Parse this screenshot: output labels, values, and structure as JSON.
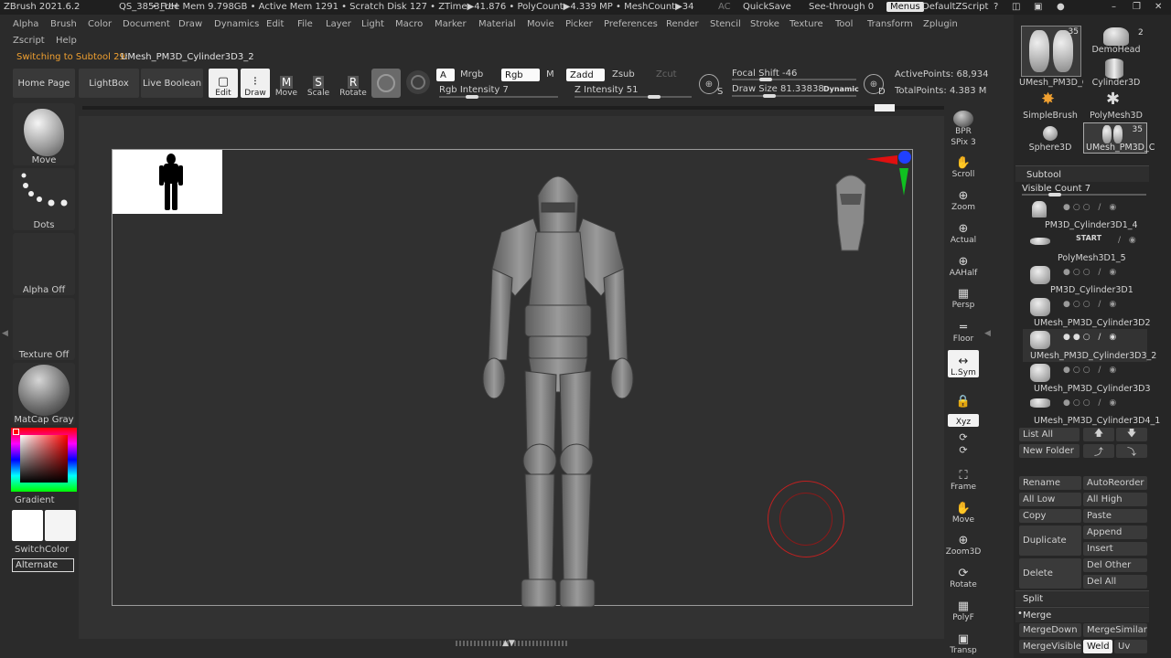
{
  "titlebar": {
    "app": "ZBrush 2021.6.2",
    "doc": "QS_3853_UH",
    "stats": "• Free Mem 9.798GB • Active Mem 1291 • Scratch Disk 127 •  ZTime▶41.876 • PolyCount▶4.339 MP  • MeshCount▶34",
    "ac": "AC",
    "quicksave": "QuickSave",
    "seethrough": "See-through  0",
    "menus": "Menus",
    "script": "DefaultZScript"
  },
  "menus": [
    "Alpha",
    "Brush",
    "Color",
    "Document",
    "Draw",
    "Dynamics",
    "Edit",
    "File",
    "Layer",
    "Light",
    "Macro",
    "Marker",
    "Material",
    "Movie",
    "Picker",
    "Preferences",
    "Render",
    "Stencil",
    "Stroke",
    "Texture",
    "Tool",
    "Transform",
    "Zplugin"
  ],
  "menus2": [
    "Zscript",
    "Help"
  ],
  "status": {
    "prefix": "Switching to Subtool 29:",
    "name": "UMesh_PM3D_Cylinder3D3_2"
  },
  "toolbar": {
    "home": "Home Page",
    "lightbox": "LightBox",
    "liveboolean": "Live Boolean",
    "edit": "Edit",
    "draw": "Draw",
    "move": "Move",
    "scale": "Scale",
    "rotate": "Rotate",
    "a": "A",
    "mrgb": "Mrgb",
    "rgb": "Rgb",
    "m": "M",
    "zadd": "Zadd",
    "zsub": "Zsub",
    "zcut": "Zcut",
    "rgb_intensity": "Rgb Intensity 7",
    "z_intensity": "Z Intensity 51",
    "focal_shift": "Focal Shift -46",
    "draw_size": "Draw Size 81.33838",
    "dynamic": "Dynamic",
    "s": "S",
    "d": "D",
    "active_points": "ActivePoints: 68,934",
    "total_points": "TotalPoints: 4.383 M"
  },
  "left": {
    "move": "Move",
    "dots": "Dots",
    "alpha": "Alpha Off",
    "texture": "Texture Off",
    "matcap": "MatCap Gray",
    "gradient": "Gradient",
    "switchcolor": "SwitchColor",
    "alternate": "Alternate"
  },
  "righttools": [
    "BPR",
    "SPix 3",
    "Scroll",
    "Zoom",
    "Actual",
    "AAHalf",
    "Persp",
    "Floor",
    "L.Sym",
    "Xyz",
    "Frame",
    "Move",
    "Zoom3D",
    "Rotate",
    "PolyF",
    "Transp"
  ],
  "tools": {
    "t1": "UMesh_PM3D_C",
    "t1n": "35",
    "t2": "DemoHead",
    "t2n": "2",
    "t3": "Cylinder3D",
    "t4": "SimpleBrush",
    "t5": "PolyMesh3D",
    "t6": "Sphere3D",
    "t7": "UMesh_PM3D_C",
    "t7n": "35"
  },
  "subtool": {
    "header": "Subtool",
    "visible": "Visible Count 7",
    "items": [
      "PM3D_Cylinder3D1_4",
      "PolyMesh3D1_5",
      "PM3D_Cylinder3D1",
      "UMesh_PM3D_Cylinder3D2",
      "UMesh_PM3D_Cylinder3D3_2",
      "UMesh_PM3D_Cylinder3D3",
      "UMesh_PM3D_Cylinder3D4_1"
    ],
    "start": "START",
    "list_all": "List All",
    "new_folder": "New Folder",
    "rename": "Rename",
    "autoreorder": "AutoReorder",
    "all_low": "All Low",
    "all_high": "All High",
    "copy": "Copy",
    "paste": "Paste",
    "duplicate": "Duplicate",
    "append": "Append",
    "insert": "Insert",
    "delete": "Delete",
    "del_other": "Del Other",
    "del_all": "Del All",
    "split": "Split",
    "merge": "Merge",
    "merge_down": "MergeDown",
    "merge_similar": "MergeSimilar",
    "merge_visible": "MergeVisible",
    "weld": "Weld",
    "uv": "Uv"
  },
  "colors": {
    "accent": "#f0a030",
    "brush_ring": "#c02020",
    "gizmo_red": "#e01010",
    "gizmo_green": "#10c020",
    "gizmo_blue": "#2040ff"
  }
}
